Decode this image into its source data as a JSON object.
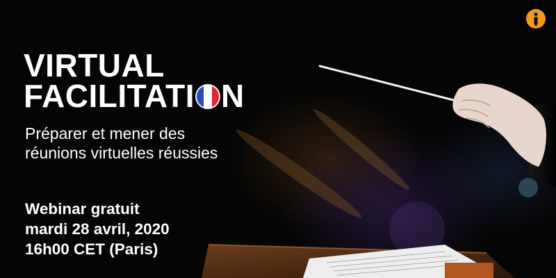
{
  "banner": {
    "title_line1": "VIRTUAL",
    "title_line2_before": "FACILITATI",
    "title_line2_after": "N",
    "subtitle_line1": "Préparer et mener des",
    "subtitle_line2": "réunions virtuelles réussies",
    "webinar_label": "Webinar gratuit",
    "date": "mardi 28 avril, 2020",
    "time": "16h00 CET (Paris)"
  },
  "icons": {
    "flag": "france-flag-icon",
    "logo": "info-logo-icon"
  },
  "colors": {
    "background": "#050505",
    "text": "#ffffff",
    "logo_orange": "#f39a1e",
    "flag_blue": "#2c4bb0",
    "flag_white": "#ffffff",
    "flag_red": "#e0253a"
  }
}
